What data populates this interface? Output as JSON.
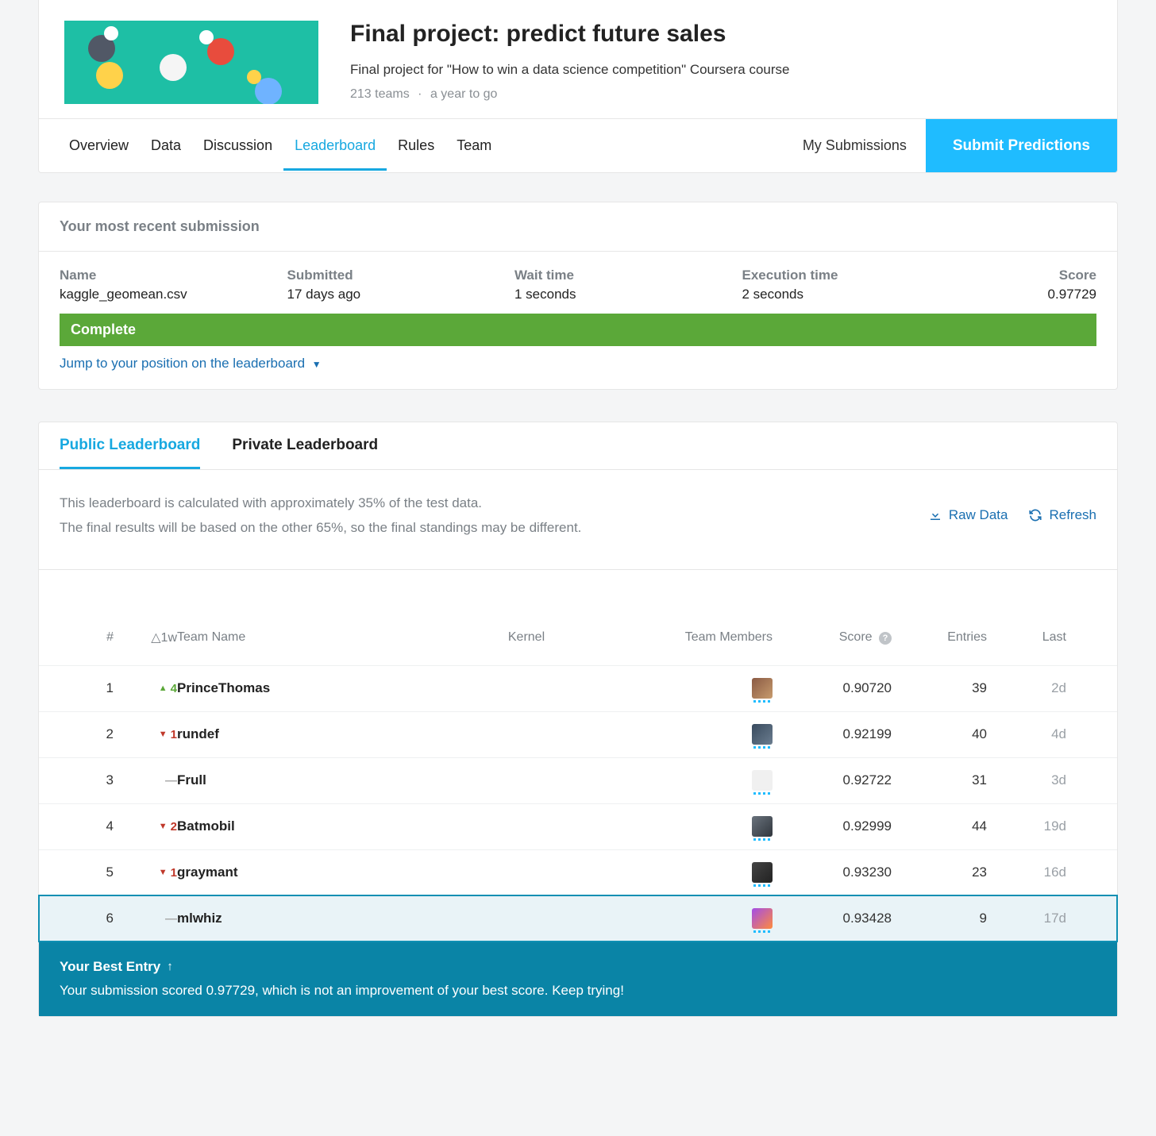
{
  "header": {
    "title": "Final project: predict future sales",
    "description": "Final project for \"How to win a data science competition\" Coursera course",
    "teams": "213 teams",
    "deadline": "a year to go"
  },
  "nav": {
    "tabs": [
      "Overview",
      "Data",
      "Discussion",
      "Leaderboard",
      "Rules",
      "Team"
    ],
    "active": "Leaderboard",
    "my_submissions": "My Submissions",
    "submit": "Submit Predictions"
  },
  "recent": {
    "heading": "Your most recent submission",
    "cols": {
      "name": {
        "label": "Name",
        "value": "kaggle_geomean.csv"
      },
      "submitted": {
        "label": "Submitted",
        "value": "17 days ago"
      },
      "wait": {
        "label": "Wait time",
        "value": "1 seconds"
      },
      "exec": {
        "label": "Execution time",
        "value": "2 seconds"
      },
      "score": {
        "label": "Score",
        "value": "0.97729"
      }
    },
    "status": "Complete",
    "jump": "Jump to your position on the leaderboard"
  },
  "lb": {
    "tabs": {
      "public": "Public Leaderboard",
      "private": "Private Leaderboard"
    },
    "info1": "This leaderboard is calculated with approximately 35% of the test data.",
    "info2": "The final results will be based on the other 65%, so the final standings may be different.",
    "raw": "Raw Data",
    "refresh": "Refresh",
    "headers": {
      "rank": "#",
      "delta": "△1w",
      "team": "Team Name",
      "kernel": "Kernel",
      "members": "Team Members",
      "score": "Score",
      "entries": "Entries",
      "last": "Last"
    },
    "rows": [
      {
        "rank": "1",
        "delta_dir": "up",
        "delta": "4",
        "team": "PrinceThomas",
        "score": "0.90720",
        "entries": "39",
        "last": "2d",
        "avatar": "p1"
      },
      {
        "rank": "2",
        "delta_dir": "down",
        "delta": "1",
        "team": "rundef",
        "score": "0.92199",
        "entries": "40",
        "last": "4d",
        "avatar": "p2"
      },
      {
        "rank": "3",
        "delta_dir": "same",
        "delta": "—",
        "team": "Frull",
        "score": "0.92722",
        "entries": "31",
        "last": "3d",
        "avatar": "p3"
      },
      {
        "rank": "4",
        "delta_dir": "down",
        "delta": "2",
        "team": "Batmobil",
        "score": "0.92999",
        "entries": "44",
        "last": "19d",
        "avatar": "p4"
      },
      {
        "rank": "5",
        "delta_dir": "down",
        "delta": "1",
        "team": "graymant",
        "score": "0.93230",
        "entries": "23",
        "last": "16d",
        "avatar": "p5"
      },
      {
        "rank": "6",
        "delta_dir": "same",
        "delta": "—",
        "team": "mlwhiz",
        "score": "0.93428",
        "entries": "9",
        "last": "17d",
        "avatar": "p6",
        "highlight": true
      }
    ]
  },
  "best": {
    "title": "Your Best Entry",
    "message": "Your submission scored 0.97729, which is not an improvement of your best score. Keep trying!"
  }
}
